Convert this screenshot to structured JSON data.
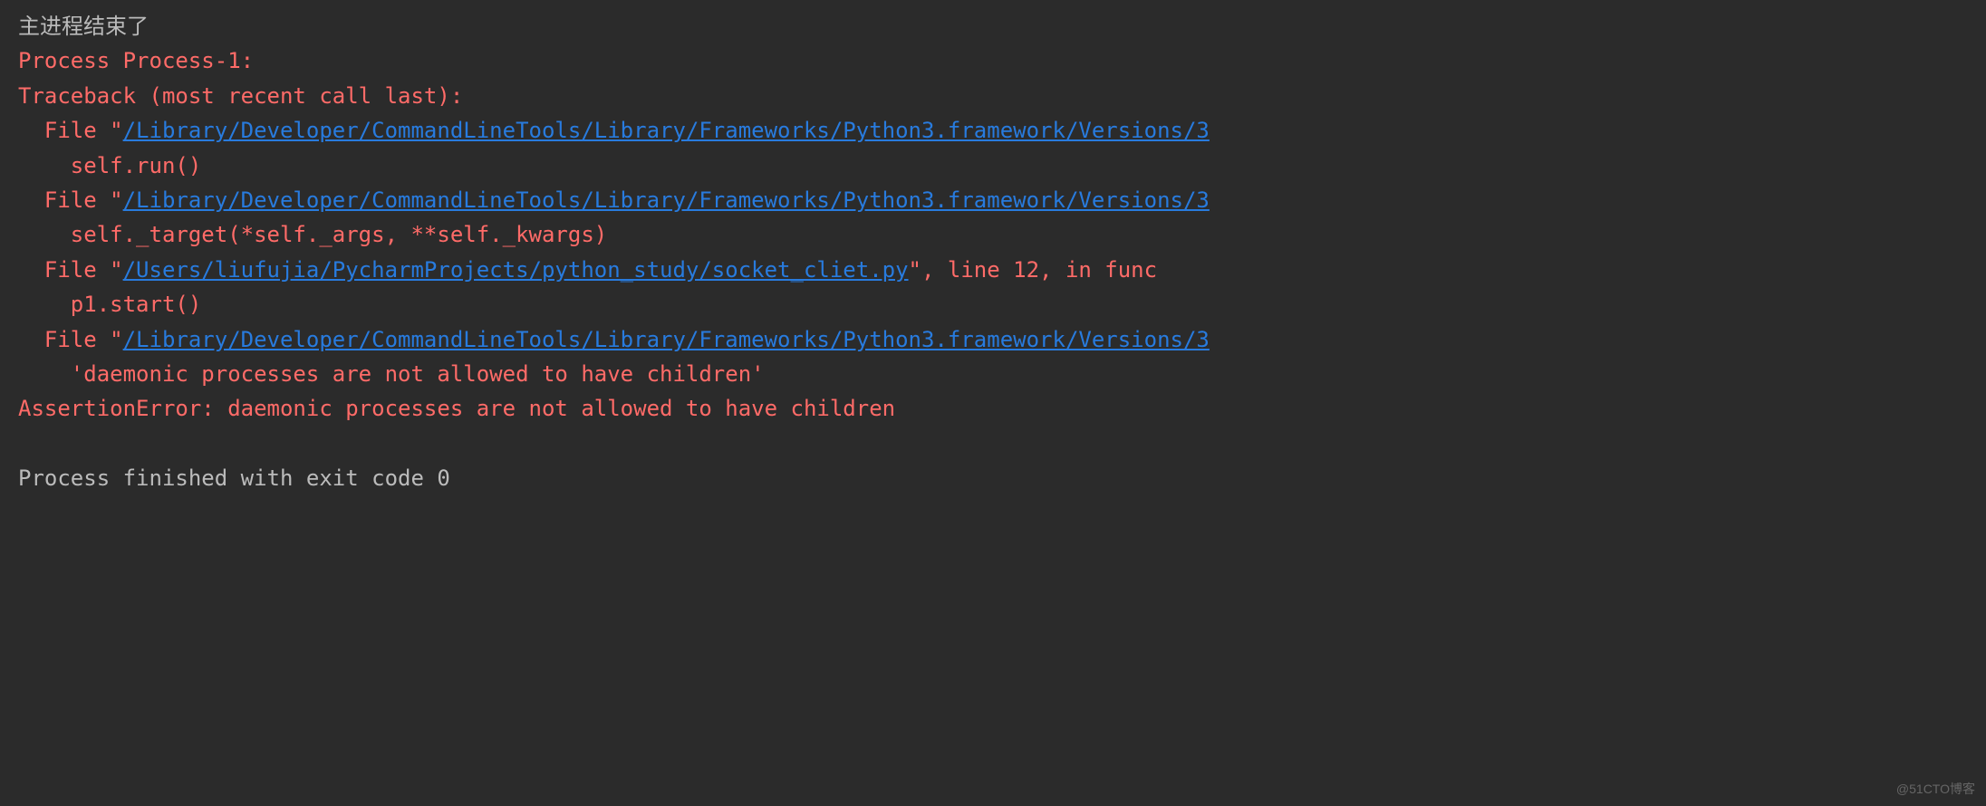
{
  "console": {
    "line1": "主进程结束了",
    "line2": "Process Process-1:",
    "line3": "Traceback (most recent call last):",
    "frame1": {
      "prefix": "File \"",
      "path": "/Library/Developer/CommandLineTools/Library/Frameworks/Python3.framework/Versions/3",
      "code": "self.run()"
    },
    "frame2": {
      "prefix": "File \"",
      "path": "/Library/Developer/CommandLineTools/Library/Frameworks/Python3.framework/Versions/3",
      "code": "self._target(*self._args, **self._kwargs)"
    },
    "frame3": {
      "prefix": "File \"",
      "path": "/Users/liufujia/PycharmProjects/python_study/socket_cliet.py",
      "suffix": "\", line 12, in func",
      "code": "p1.start()"
    },
    "frame4": {
      "prefix": "File \"",
      "path": "/Library/Developer/CommandLineTools/Library/Frameworks/Python3.framework/Versions/3",
      "code": "'daemonic processes are not allowed to have children'"
    },
    "error": "AssertionError: daemonic processes are not allowed to have children",
    "exit": "Process finished with exit code 0"
  },
  "watermark": "@51CTO博客"
}
